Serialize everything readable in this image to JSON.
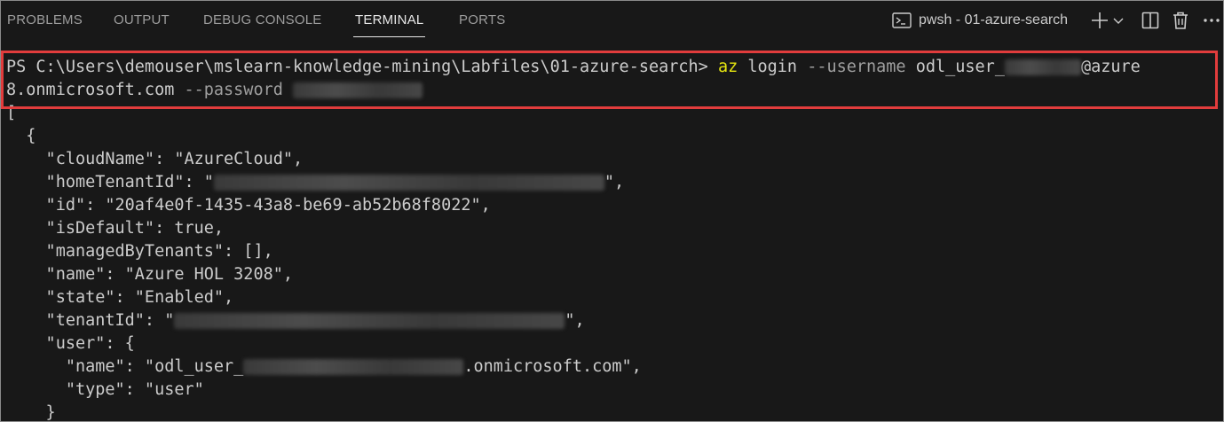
{
  "tabs": [
    {
      "label": "PROBLEMS"
    },
    {
      "label": "OUTPUT"
    },
    {
      "label": "DEBUG CONSOLE"
    },
    {
      "label": "TERMINAL",
      "active": true
    },
    {
      "label": "PORTS"
    }
  ],
  "terminal_instance": {
    "label": "pwsh - 01-azure-search",
    "icon": "terminal-powershell-icon"
  },
  "toolbar_icons": [
    "add-icon",
    "chevron-down-icon",
    "split-icon",
    "trash-icon",
    "more-icon"
  ],
  "highlight_color": "#e13c3c",
  "terminal": {
    "prompt": "PS C:\\Users\\demouser\\mslearn-knowledge-mining\\Labfiles\\01-azure-search> ",
    "cmd_az": "az",
    "cmd_login": " login ",
    "opt_username": "--username",
    "username_prefix": " odl_user_",
    "username_suffix": "@azure",
    "line2_domain": "8.onmicrosoft.com ",
    "opt_password": "--password",
    "open_bracket": "[",
    "open_brace": "  {",
    "cloudName": "    \"cloudName\": \"AzureCloud\",",
    "homeTenantId_pre": "    \"homeTenantId\": \"",
    "homeTenantId_post": "\",",
    "id": "    \"id\": \"20af4e0f-1435-43a8-be69-ab52b68f8022\",",
    "isDefault": "    \"isDefault\": true,",
    "managedByTenants": "    \"managedByTenants\": [],",
    "name": "    \"name\": \"Azure HOL 3208\",",
    "state": "    \"state\": \"Enabled\",",
    "tenantId_pre": "    \"tenantId\": \"",
    "tenantId_post": "\",",
    "user_open": "    \"user\": {",
    "user_name_pre": "      \"name\": \"odl_user_",
    "user_name_post": ".onmicrosoft.com\",",
    "user_type": "      \"type\": \"user\"",
    "user_close": "    }"
  }
}
